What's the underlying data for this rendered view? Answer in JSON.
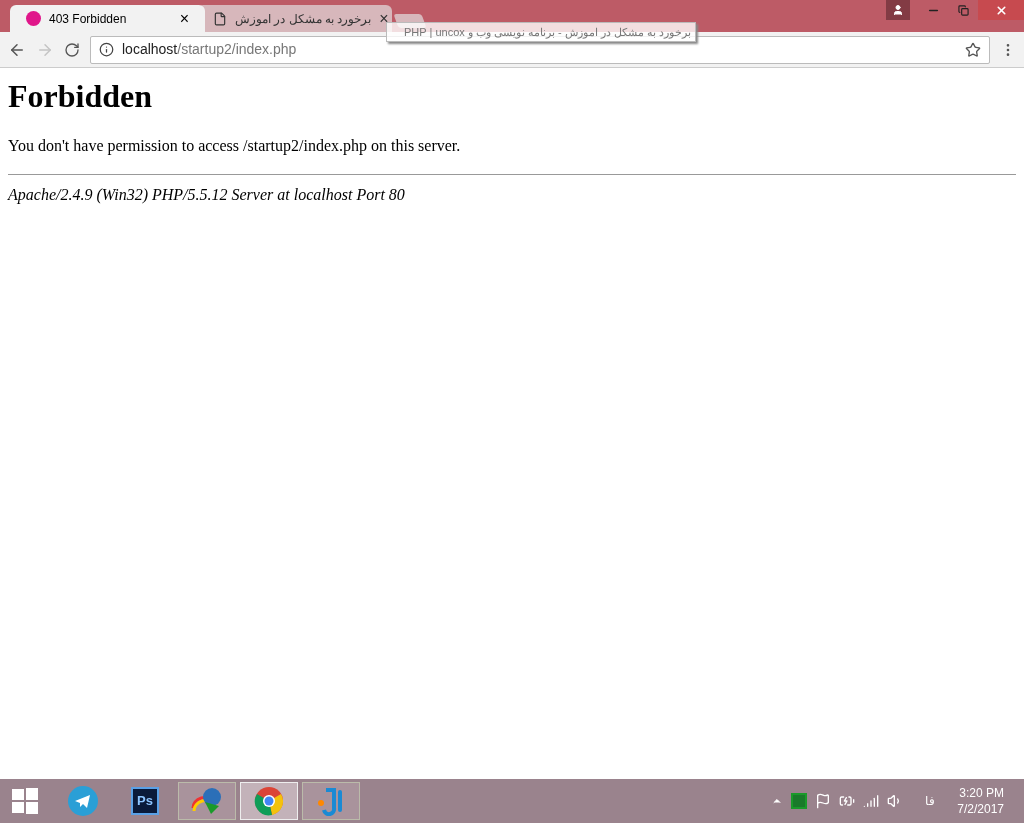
{
  "tabs": [
    {
      "title": "403 Forbidden",
      "kind": "wamp",
      "selected": true,
      "close": "×"
    },
    {
      "title": "برخورد به مشکل در اموزش",
      "kind": "page",
      "selected": false,
      "close": "×"
    }
  ],
  "tooltip": "برخورد به مشکل در اموزش - برنامه نویسی وب و PHP | uncox",
  "address": {
    "host": "localhost",
    "path": "/startup2/index.php"
  },
  "page": {
    "heading": "Forbidden",
    "message": "You don't have permission to access /startup2/index.php on this server.",
    "signature": "Apache/2.4.9 (Win32) PHP/5.5.12 Server at localhost Port 80"
  },
  "taskbar": {
    "apps": [
      {
        "kind": "telegram",
        "selected": false
      },
      {
        "kind": "photoshop",
        "label": "Ps",
        "selected": false
      },
      {
        "kind": "downloader",
        "selected": false
      },
      {
        "kind": "chrome",
        "selected": true
      },
      {
        "kind": "ide",
        "selected": false
      }
    ],
    "language": "فا",
    "time": "3:20 PM",
    "date": "7/2/2017"
  }
}
